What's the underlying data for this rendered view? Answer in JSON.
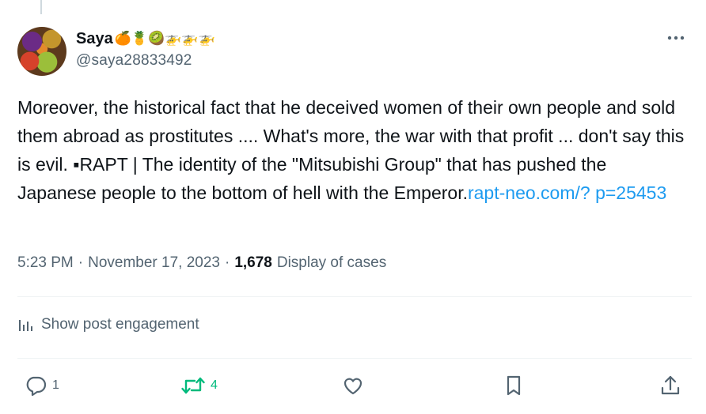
{
  "user": {
    "display_name": "Saya",
    "name_emojis": "🍊🍍🥝🚁🚁🚁",
    "handle": "@saya28833492"
  },
  "post": {
    "text": "Moreover, the historical fact that he deceived women of their own people and sold them abroad as prostitutes ....  What's more, the war with that profit ... don't say this is evil.  ▪RAPT | The identity of the \"Mitsubishi Group\" that has pushed the Japanese people to the bottom of hell with the Emperor.",
    "link": "rapt-neo.com/? p=25453",
    "time": "5:23 PM",
    "date": "November 17, 2023",
    "views_count": "1,678",
    "views_label": "Display of cases"
  },
  "engagement": {
    "label": "Show post engagement"
  },
  "actions": {
    "reply_count": "1",
    "retweet_count": "4"
  },
  "colors": {
    "link": "#1d9bf0",
    "retweet": "#00ba7c",
    "secondary": "#536471"
  }
}
